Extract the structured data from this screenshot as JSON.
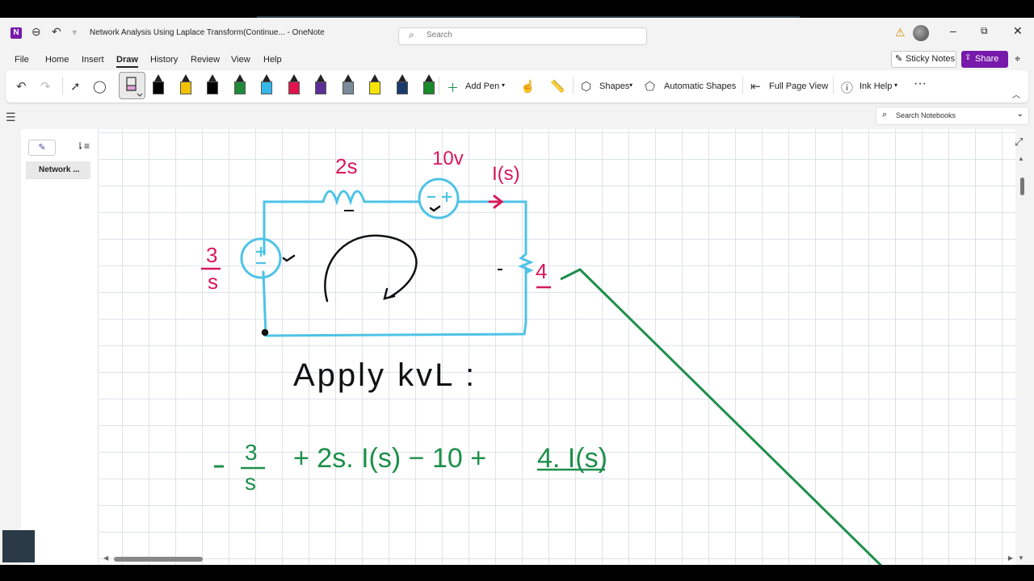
{
  "window": {
    "app_logo": "N",
    "doc_title": "Network Analysis Using Laplace Transform(Continue...  -  OneNote",
    "search_placeholder": "Search"
  },
  "menu": [
    "File",
    "Home",
    "Insert",
    "Draw",
    "History",
    "Review",
    "View",
    "Help"
  ],
  "menu_active": "Draw",
  "header_buttons": {
    "sticky_notes": "Sticky Notes",
    "share": "Share"
  },
  "ribbon": {
    "add_pen": "Add Pen",
    "shapes": "Shapes",
    "automatic_shapes": "Automatic Shapes",
    "full_page_view": "Full Page View",
    "ink_help": "Ink Help",
    "more": "···",
    "pen_colors": [
      "#000000",
      "#f2c200",
      "#000000",
      "#1f8a3a",
      "#35b7e8",
      "#e0144c",
      "#5b2f91",
      "#7a8a9a",
      "#f5e400",
      "#1a3a6a",
      "#1a8a2a"
    ]
  },
  "notebook_search": "Search Notebooks",
  "pages": [
    {
      "label": "Network ..."
    }
  ],
  "ink": {
    "inductor": "2s",
    "source_top": "10v",
    "current": "I(s)",
    "source_left_num": "3",
    "source_left_den": "s",
    "resistor": "4",
    "heading": "Apply kvL :",
    "equation": {
      "t1_num": "3",
      "t1_den": "s",
      "t2": "+ 2s. I(s) − 10 + ",
      "t3": "4. I(s)"
    },
    "colors": {
      "circuit": "#4ec3e6",
      "label": "#d8185a",
      "equation": "#1e8f4a",
      "ink": "#111111"
    }
  }
}
